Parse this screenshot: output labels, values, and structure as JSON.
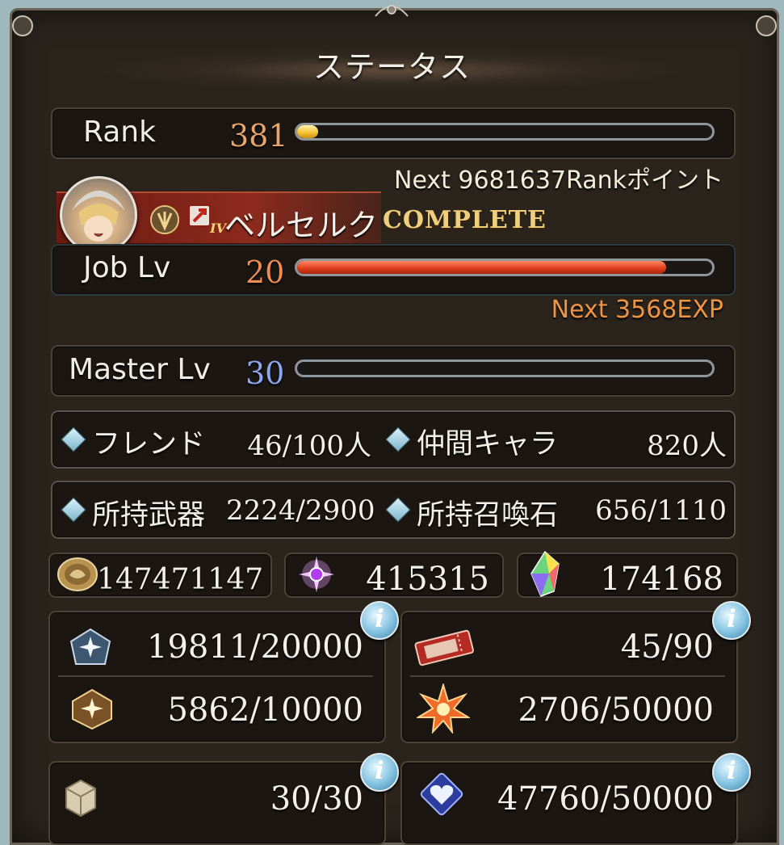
{
  "title": "ステータス",
  "rank": {
    "label": "Rank",
    "value": "381",
    "progress": 0.03,
    "next_text": "Next 9681637Rankポイント"
  },
  "job": {
    "name": "ベルセルク",
    "status": "COMPLETE",
    "level_label": "IV"
  },
  "job_lv": {
    "label": "Job Lv",
    "value": "20",
    "progress": 0.89,
    "next_text": "Next 3568EXP"
  },
  "master_lv": {
    "label": "Master Lv",
    "value": "30",
    "progress": 0.0
  },
  "counts": {
    "friend": {
      "label": "フレンド",
      "value": "46/100人"
    },
    "crew": {
      "label": "仲間キャラ",
      "value": "820人"
    },
    "weapons": {
      "label": "所持武器",
      "value": "2224/2900"
    },
    "summons": {
      "label": "所持召喚石",
      "value": "656/1110"
    }
  },
  "currency": {
    "rupie": {
      "icon": "rupie-icon",
      "value": "147471147"
    },
    "crystal": {
      "icon": "crystal-icon",
      "value": "415315"
    },
    "gem": {
      "icon": "rainbow-gem-icon",
      "value": "174168"
    }
  },
  "resources": {
    "ap": {
      "icon": "ap-icon",
      "value": "19811/20000"
    },
    "ep": {
      "icon": "ep-icon",
      "value": "5862/10000"
    },
    "ticket": {
      "icon": "ticket-icon",
      "value": "45/90"
    },
    "burst": {
      "icon": "burst-icon",
      "value": "2706/50000"
    },
    "box": {
      "icon": "box-icon",
      "value": "30/30"
    },
    "heart": {
      "icon": "heart-icon",
      "value": "47760/50000"
    }
  },
  "info_label": "i",
  "colors": {
    "rank": "#e7a56b",
    "job": "#ee8c54",
    "master": "#8da7ee",
    "bar_red": "#e2401e",
    "bar_gold": "#f5c02f"
  }
}
